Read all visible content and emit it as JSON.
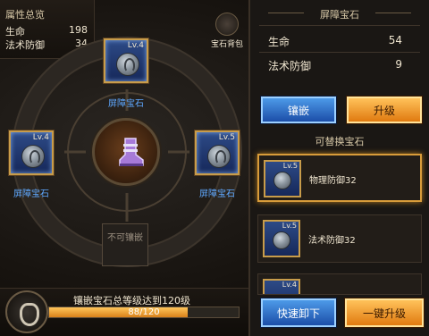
{
  "stats": {
    "title": "属性总览",
    "rows": [
      {
        "label": "生命",
        "value": "198"
      },
      {
        "label": "法术防御",
        "value": "34"
      }
    ]
  },
  "slots": {
    "top": {
      "level": "Lv.4",
      "name": "屏障宝石"
    },
    "left": {
      "level": "Lv.4",
      "name": "屏障宝石"
    },
    "right": {
      "level": "Lv.5",
      "name": "屏障宝石"
    },
    "locked_label": "不可镶嵌"
  },
  "gem_bag": {
    "label": "宝石背包",
    "icon": "gem-bag-icon"
  },
  "progress": {
    "title": "镶嵌宝石总等级达到120级",
    "current": 88,
    "max": 120,
    "text": "88/120"
  },
  "selected": {
    "title": "屏障宝石",
    "rows": [
      {
        "label": "生命",
        "value": "54"
      },
      {
        "label": "法术防御",
        "value": "9"
      }
    ],
    "inlay_button": "镶嵌",
    "upgrade_button": "升级"
  },
  "replaceable": {
    "title": "可替换宝石",
    "items": [
      {
        "level": "Lv.5",
        "name": "物理防御32"
      },
      {
        "level": "Lv.5",
        "name": "法术防御32"
      },
      {
        "level": "Lv.4",
        "name": ""
      }
    ]
  },
  "actions": {
    "quick_unload": "快速卸下",
    "one_click_upgrade": "一键升级"
  },
  "colors": {
    "slot_blue": "#2d4a86",
    "frame_gold": "#c89c4a",
    "label_blue": "#5fa8ff",
    "button_blue": "#4d9ae8",
    "button_orange": "#ffc25a"
  }
}
